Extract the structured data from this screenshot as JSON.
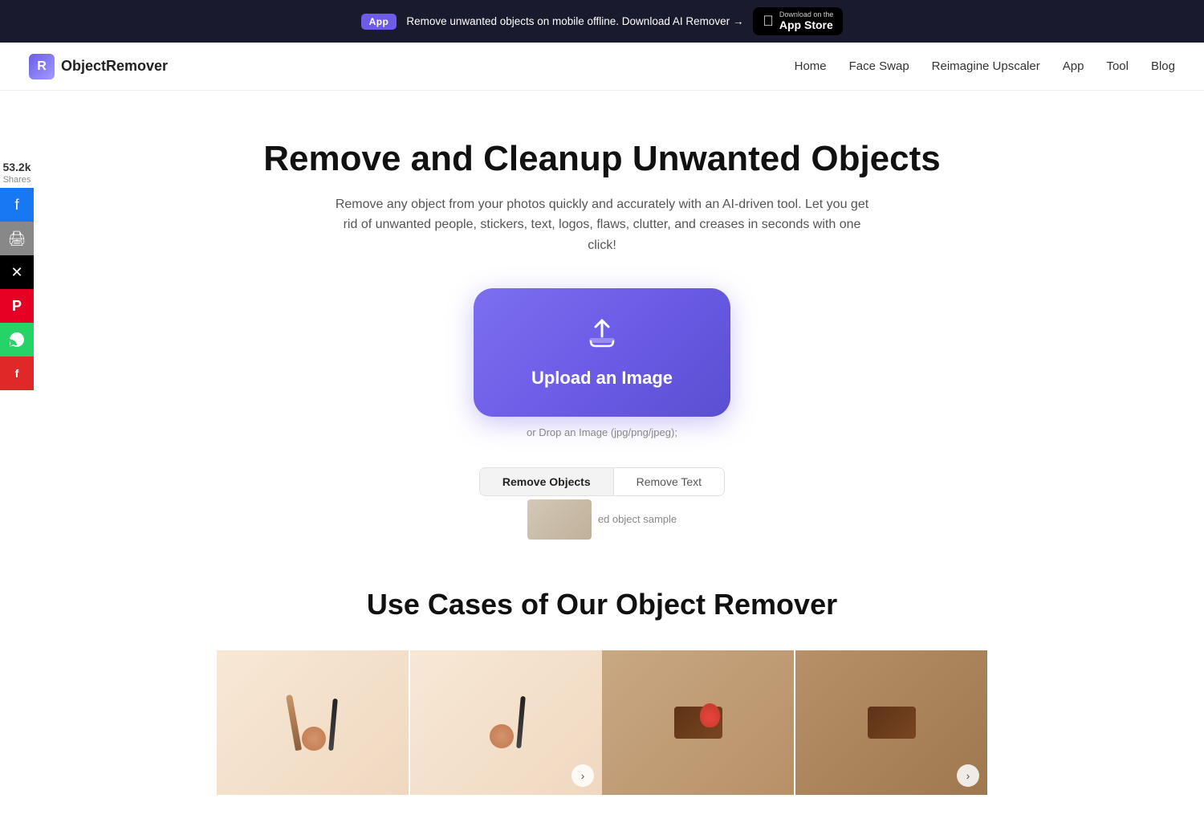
{
  "banner": {
    "app_badge": "App",
    "text": "Remove unwanted objects on mobile offline. Download AI Remover →",
    "appstore_small": "Download on the",
    "appstore_large": "App Store"
  },
  "nav": {
    "logo_text": "ObjectRemover",
    "links": [
      "Home",
      "Face Swap",
      "Reimagine Upscaler",
      "App",
      "Tool",
      "Blog"
    ]
  },
  "hero": {
    "title": "Remove and Cleanup Unwanted Objects",
    "subtitle": "Remove any object from your photos quickly and accurately with an AI-driven tool. Let you get rid of unwanted people, stickers, text, logos, flaws, clutter, and creases in seconds with one click!",
    "upload_label": "Upload an Image",
    "drop_hint": "or Drop an Image (jpg/png/jpeg);"
  },
  "tabs": [
    {
      "label": "Remove Objects",
      "active": true
    },
    {
      "label": "Remove Text",
      "active": false
    }
  ],
  "sample": {
    "label": "ed object sample"
  },
  "social": {
    "count": "53.2k",
    "shares_label": "Shares",
    "buttons": [
      {
        "name": "facebook",
        "icon": "f",
        "class": "fb"
      },
      {
        "name": "print",
        "icon": "🖨",
        "class": "print"
      },
      {
        "name": "twitter-x",
        "icon": "✕",
        "class": "tw"
      },
      {
        "name": "pinterest",
        "icon": "P",
        "class": "pin"
      },
      {
        "name": "whatsapp",
        "icon": "w",
        "class": "wa"
      },
      {
        "name": "flipboard",
        "icon": "f",
        "class": "flip"
      }
    ]
  },
  "use_cases": {
    "title": "Use Cases of Our Object Remover",
    "cards": [
      {
        "id": "makeup",
        "alt": "Makeup before/after"
      },
      {
        "id": "food",
        "alt": "Food before/after"
      }
    ]
  }
}
